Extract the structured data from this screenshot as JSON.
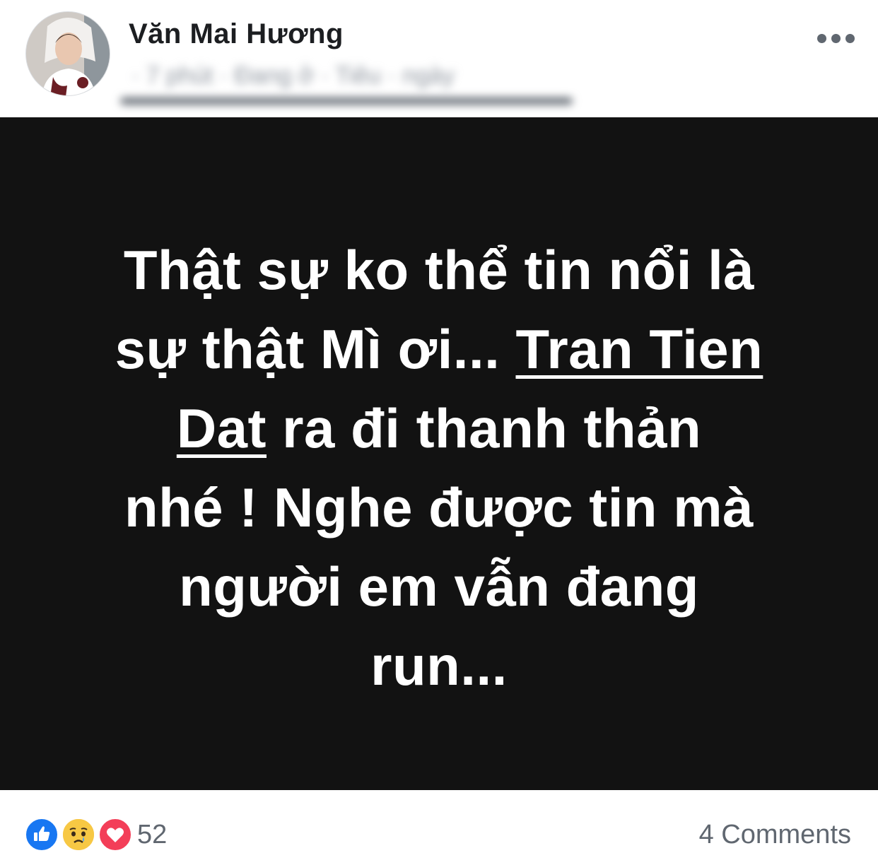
{
  "post": {
    "author_name": "Văn Mai Hương",
    "meta_blurred": "· 7 phút · Đang ở · Tiêu · ngày",
    "more_icon": "more-horizontal-icon",
    "status": {
      "line1": "Thật sự ko thể tin nổi là",
      "line2_pre": "sự thật Mì ơi... ",
      "mention_part1": "Tran Tien",
      "mention_part2": "Dat",
      "line3_post": " ra đi thanh thản",
      "line4": "nhé ! Nghe được tin mà",
      "line5": "người em vẫn đang",
      "line6": "run..."
    },
    "background_color": "#121212",
    "text_color": "#ffffff"
  },
  "footer": {
    "reactions": [
      "like-icon",
      "sad-icon",
      "love-icon"
    ],
    "reaction_colors": {
      "like": "#1877f2",
      "sad": "#f7b125",
      "love": "#f33e58"
    },
    "reaction_count": "52",
    "comments_label": "4 Comments"
  }
}
